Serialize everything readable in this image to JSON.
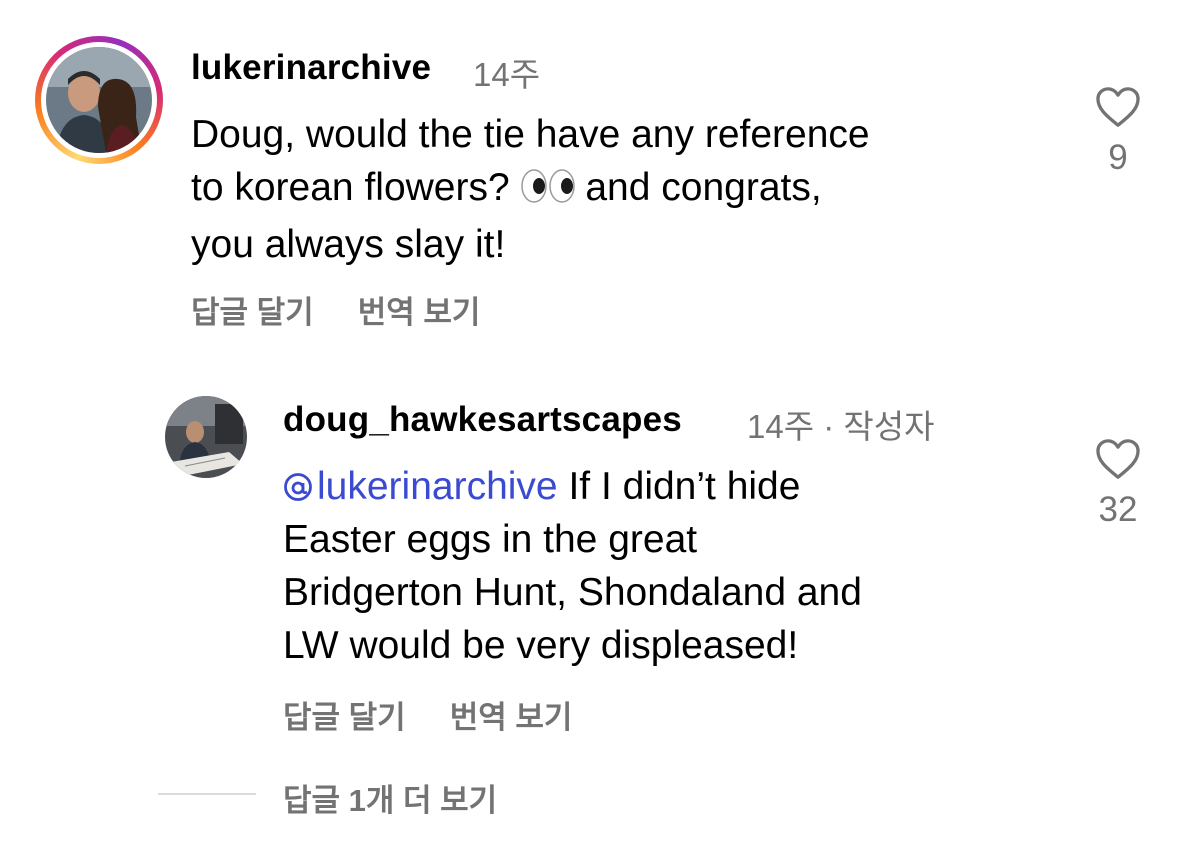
{
  "comments": [
    {
      "username": "lukerinarchive",
      "time": "14주",
      "text": "Doug, would the tie have any reference to korean flowers? 👀 and congrats, you always slay it!",
      "text_line1": "Doug, would the tie have any reference",
      "text_line2a": "to korean flowers?",
      "text_line2b": "and congrats,",
      "text_line3": "you always slay it!",
      "reply_label": "답글 달기",
      "translate_label": "번역 보기",
      "like_count": "9"
    },
    {
      "username": "doug_hawkesartscapes",
      "time": "14주",
      "separator": "·",
      "author_badge": "작성자",
      "mention": "lukerinarchive",
      "text_line1": "If I didn’t hide",
      "text_line2": "Easter eggs in the great",
      "text_line3": "Bridgerton Hunt, Shondaland and",
      "text_line4": "LW would be very displeased!",
      "reply_label": "답글 달기",
      "translate_label": "번역 보기",
      "like_count": "32"
    }
  ],
  "view_more_replies": "답글 1개 더 보기",
  "icons": {
    "like": "heart-outline-icon",
    "mention": "threads-at-icon",
    "emoji": "eyes-emoji"
  },
  "colors": {
    "meta_gray": "#737373",
    "mention_blue": "#3b4bd1",
    "story_ring": "#d62976"
  }
}
